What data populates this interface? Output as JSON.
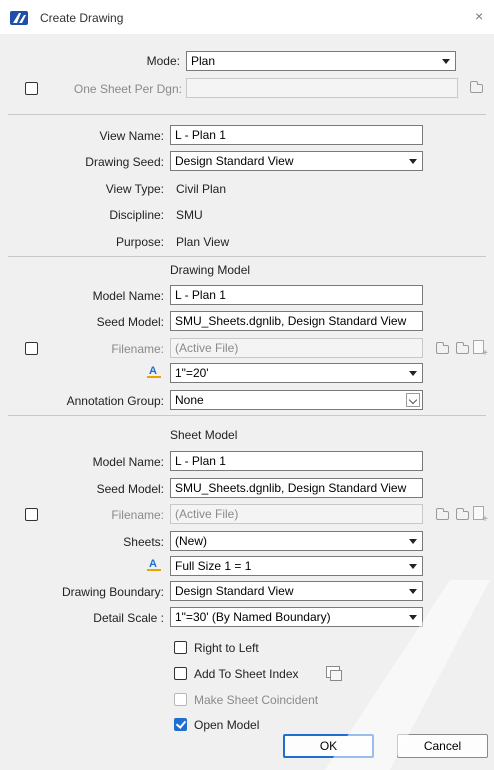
{
  "window": {
    "title": "Create Drawing",
    "close_glyph": "×",
    "app_icon": "app-logo-icon"
  },
  "mode": {
    "label": "Mode:",
    "value": "Plan"
  },
  "one_sheet": {
    "label": "One Sheet Per Dgn:",
    "value": ""
  },
  "view": {
    "name_label": "View Name:",
    "name_value": "L - Plan 1",
    "seed_label": "Drawing Seed:",
    "seed_value": "Design Standard View",
    "type_label": "View Type:",
    "type_value": "Civil Plan",
    "discipline_label": "Discipline:",
    "discipline_value": "SMU",
    "purpose_label": "Purpose:",
    "purpose_value": "Plan View"
  },
  "drawing_model": {
    "section": "Drawing Model",
    "model_name_label": "Model Name:",
    "model_name_value": "L - Plan 1",
    "seed_label": "Seed Model:",
    "seed_value": "SMU_Sheets.dgnlib, Design Standard View",
    "filename_label": "Filename:",
    "filename_value": "(Active File)",
    "scale_value": "1\"=20'",
    "anno_label": "Annotation Group:",
    "anno_value": "None"
  },
  "sheet_model": {
    "section": "Sheet Model",
    "model_name_label": "Model Name:",
    "model_name_value": "L - Plan 1",
    "seed_label": "Seed Model:",
    "seed_value": "SMU_Sheets.dgnlib, Design Standard View",
    "filename_label": "Filename:",
    "filename_value": "(Active File)",
    "sheets_label": "Sheets:",
    "sheets_value": "(New)",
    "scale_value": "Full Size 1 = 1",
    "boundary_label": "Drawing Boundary:",
    "boundary_value": "Design Standard View",
    "detail_label": "Detail Scale :",
    "detail_value": "1\"=30' (By Named Boundary)"
  },
  "options": {
    "right_to_left": "Right to Left",
    "add_to_sheet_index": "Add To Sheet Index",
    "make_coincident": "Make Sheet Coincident",
    "open_model": "Open Model"
  },
  "buttons": {
    "ok": "OK",
    "cancel": "Cancel"
  },
  "colors": {
    "accent": "#1f6fd1",
    "logo": "#1f4fa8"
  }
}
